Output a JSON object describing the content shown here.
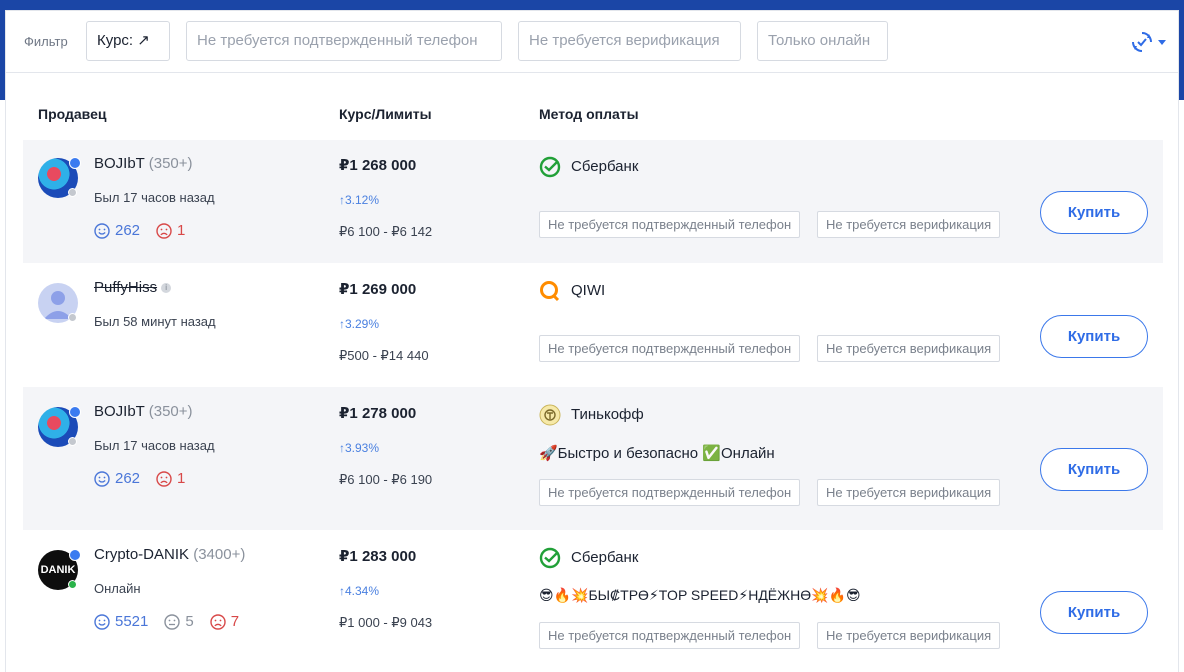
{
  "filter": {
    "label": "Фильтр",
    "chips": [
      {
        "label": "Курс: ↗",
        "active": true
      },
      {
        "label": "Не требуется подтвержденный телефон",
        "active": false
      },
      {
        "label": "Не требуется верификация",
        "active": false
      },
      {
        "label": "Только онлайн",
        "active": false
      }
    ]
  },
  "table": {
    "headers": {
      "seller": "Продавец",
      "rate": "Курс/Лимиты",
      "method": "Метод оплаты"
    }
  },
  "tags": {
    "phone": "Не требуется подтвержденный телефон",
    "verification": "Не требуется верификация"
  },
  "buy_label": "Купить",
  "offers": [
    {
      "name": "BOJIbT",
      "score": "(350+)",
      "last_seen": "Был 17 часов назад",
      "likes": "262",
      "dislikes": "1",
      "price": "₽1 268 000",
      "pct": "↑3.12%",
      "limits": "₽6 100 - ₽6 142",
      "method": "Сбербанк",
      "method_icon": "sberbank-icon"
    },
    {
      "name": "PuffyHiss",
      "last_seen": "Был 58 минут назад",
      "price": "₽1 269 000",
      "pct": "↑3.29%",
      "limits": "₽500 - ₽14 440",
      "method": "QIWI",
      "method_icon": "qiwi-icon"
    },
    {
      "name": "BOJIbT",
      "score": "(350+)",
      "last_seen": "Был 17 часов назад",
      "likes": "262",
      "dislikes": "1",
      "price": "₽1 278 000",
      "pct": "↑3.93%",
      "limits": "₽6 100 - ₽6 190",
      "method": "Тинькофф",
      "method_icon": "tinkoff-icon",
      "description": "🚀Быстро и безопасно ✅Онлайн"
    },
    {
      "name": "Crypto-DANIK",
      "score": "(3400+)",
      "last_seen": "Онлайн",
      "avatar_text": "DANIK",
      "likes": "5521",
      "neutral": "5",
      "dislikes": "7",
      "price": "₽1 283 000",
      "pct": "↑4.34%",
      "limits": "₽1 000 - ₽9 043",
      "method": "Сбербанк",
      "method_icon": "sberbank-icon",
      "description": "😎🔥💥БЫ₡ТРӨ⚡TOP SPEED⚡НДЁЖНӨ💥🔥😎"
    }
  ],
  "colors": {
    "accent": "#2f6ce6",
    "header_band": "#1b46a6",
    "negative": "#d84848",
    "online": "#2bb34a"
  }
}
